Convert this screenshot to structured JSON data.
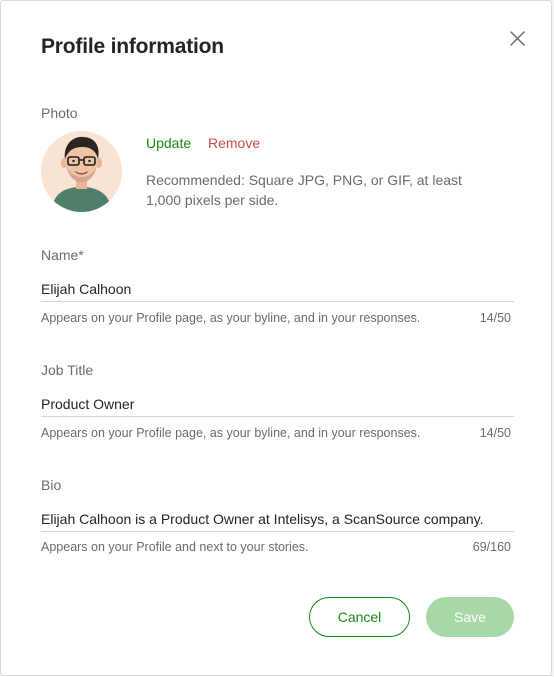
{
  "modal": {
    "title": "Profile information"
  },
  "photo": {
    "label": "Photo",
    "update_label": "Update",
    "remove_label": "Remove",
    "hint": "Recommended: Square JPG, PNG, or GIF, at least 1,000 pixels per side."
  },
  "fields": [
    {
      "label": "Name*",
      "value": "Elijah Calhoon",
      "help": "Appears on your Profile page, as your byline, and in your responses.",
      "count": "14/50"
    },
    {
      "label": "Job Title",
      "value": "Product Owner",
      "help": "Appears on your Profile page, as your byline, and in your responses.",
      "count": "14/50"
    },
    {
      "label": "Bio",
      "value": "Elijah Calhoon is a Product Owner at Intelisys, a ScanSource company.",
      "help": "Appears on your Profile and next to your stories.",
      "count": "69/160"
    }
  ],
  "actions": {
    "cancel_label": "Cancel",
    "save_label": "Save"
  },
  "colors": {
    "accent": "#1a8917",
    "remove": "#c94a4a",
    "save_disabled": "#a8d8a8"
  },
  "icons": {
    "close": "close-icon",
    "avatar": "avatar-illustration"
  }
}
